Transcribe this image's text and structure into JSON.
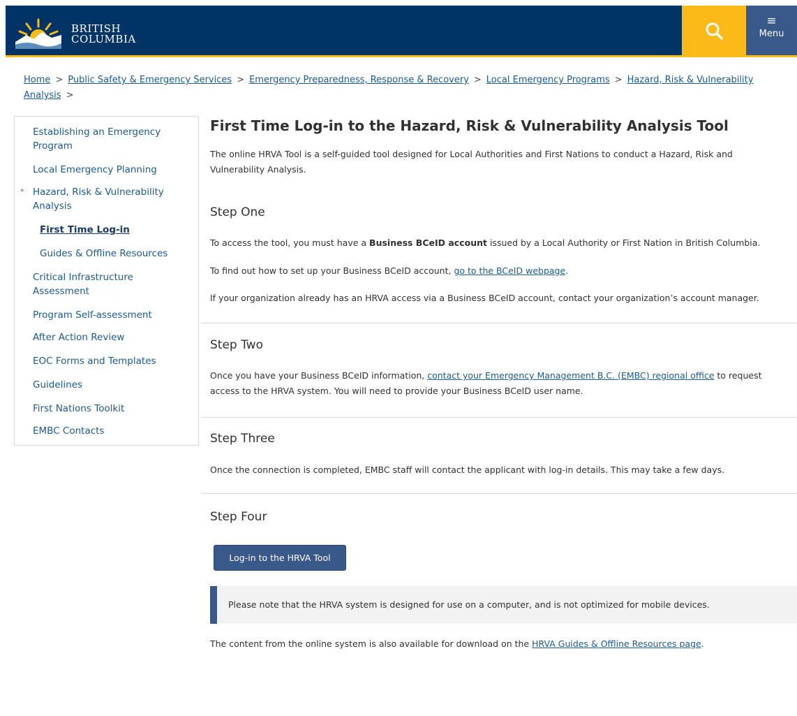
{
  "header": {
    "logo_line1": "BRITISH",
    "logo_line2": "COLUMBIA",
    "search_icon": "search-icon",
    "menu_icon": "hamburger-icon",
    "menu_label": "Menu",
    "colors": {
      "navy": "#003366",
      "gold": "#fcba19",
      "menu_bg": "#38598a"
    }
  },
  "breadcrumb": {
    "items": [
      "Home",
      "Public Safety & Emergency Services",
      "Emergency Preparedness, Response & Recovery",
      "Local Emergency Programs",
      "Hazard, Risk & Vulnerability Analysis"
    ],
    "separator": ">"
  },
  "sidebar": {
    "items": [
      "Establishing an Emergency Program",
      "Local Emergency Planning",
      "Hazard, Risk & Vulnerability Analysis",
      "First Time Log-in",
      "Guides & Offline Resources",
      "Critical Infrastructure Assessment",
      "Program Self-assessment",
      "After Action Review",
      "EOC Forms and Templates",
      "Guidelines",
      "First Nations Toolkit",
      "EMBC Contacts"
    ],
    "expanded_marker": "*"
  },
  "main": {
    "title": "First Time Log-in to the Hazard, Risk & Vulnerability Analysis Tool",
    "intro": "The online HRVA Tool is a self-guided tool designed for Local Authorities and First Nations to conduct a Hazard, Risk and Vulnerability Analysis.",
    "step1": {
      "heading": "Step One",
      "p1_pre": "To access the tool, you must have a ",
      "p1_bold": "Business BCeID account",
      "p1_post": " issued by a Local Authority or First Nation in British Columbia.",
      "p2_pre": "To find out how to set up your Business BCeID account, ",
      "p2_link": "go to the BCeID webpage",
      "p2_post": ".",
      "p3": "If your organization already has an HRVA access via a Business BCeID account, contact your organization’s account manager."
    },
    "step2": {
      "heading": "Step Two",
      "p1_pre": "Once you have your Business BCeID information, ",
      "p1_link": "contact your Emergency Management B.C. (EMBC) regional office",
      "p1_post": " to request access to the HRVA system. You will need to provide your Business BCeID user name."
    },
    "step3": {
      "heading": "Step Three",
      "p1": "Once the connection is completed, EMBC staff will contact the applicant with log-in details. This may take a few days."
    },
    "step4": {
      "heading": "Step Four",
      "button_label": "Log-in to the HRVA Tool"
    },
    "note": "Please note that the HRVA system is designed for use on a computer, and is not optimized for mobile devices.",
    "footer_pre": "The content from the online system is also available for download on the ",
    "footer_link": "HRVA Guides & Offline Resources page",
    "footer_post": "."
  }
}
